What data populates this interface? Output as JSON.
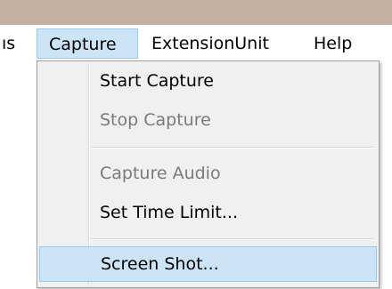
{
  "menubar": {
    "items": [
      {
        "label": "ıs"
      },
      {
        "label": "Capture"
      },
      {
        "label": "ExtensionUnit"
      },
      {
        "label": "Help"
      }
    ]
  },
  "capture_menu": {
    "items": [
      {
        "label": "Start Capture",
        "enabled": true
      },
      {
        "label": "Stop Capture",
        "enabled": false
      },
      {
        "label": "Capture Audio",
        "enabled": false
      },
      {
        "label": "Set Time Limit...",
        "enabled": true
      },
      {
        "label": "Screen Shot...",
        "enabled": true,
        "highlighted": true
      }
    ]
  },
  "colors": {
    "title_bar": "#c4b0a0",
    "highlight_fill": "#cce4f7",
    "highlight_border": "#99c9ef",
    "menu_background": "#f0f0f0",
    "disabled_text": "#7a7a7a"
  }
}
